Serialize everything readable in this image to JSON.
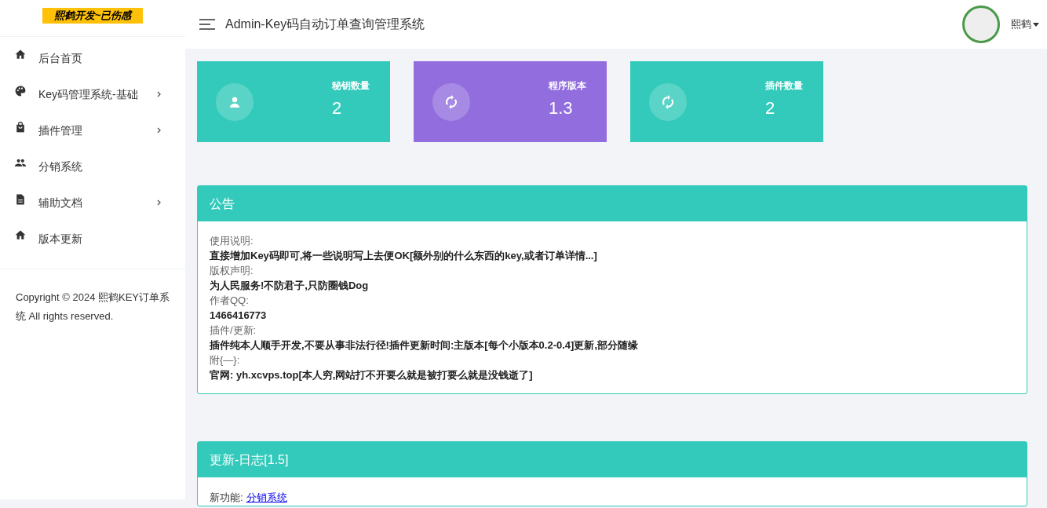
{
  "sidebar": {
    "logo": "熙鹤开发~已伤感",
    "items": [
      {
        "label": "后台首页",
        "kind": "home",
        "has_submenu": false
      },
      {
        "label": "Key码管理系统-基础",
        "kind": "palette",
        "has_submenu": true
      },
      {
        "label": "插件管理",
        "kind": "bag",
        "has_submenu": true
      },
      {
        "label": "分销系统",
        "kind": "people",
        "has_submenu": false
      },
      {
        "label": "辅助文档",
        "kind": "document",
        "has_submenu": true
      },
      {
        "label": "版本更新",
        "kind": "home",
        "has_submenu": false
      }
    ],
    "copyright": "Copyright © 2024 熙鹤KEY订单系统 All rights reserved."
  },
  "header": {
    "title": "Admin-Key码自动订单查询管理系统",
    "user": "熙鹤"
  },
  "stats": [
    {
      "label": "秘钥数量",
      "value": "2",
      "kind": "user",
      "color": "#33cabb"
    },
    {
      "label": "程序版本",
      "value": "1.3",
      "kind": "refresh",
      "color": "#926dde"
    },
    {
      "label": "插件数量",
      "value": "2",
      "kind": "refresh",
      "color": "#33cabb"
    }
  ],
  "notice": {
    "title": "公告",
    "lines": [
      {
        "kind": "label",
        "text": "使用说明:"
      },
      {
        "kind": "value",
        "text": "直接增加Key码即可,将一些说明写上去便OK[额外别的什么东西的key,或者订单详情...]"
      },
      {
        "kind": "label",
        "text": "版权声明:"
      },
      {
        "kind": "value",
        "text": "为人民服务!不防君子,只防圈钱Dog"
      },
      {
        "kind": "label",
        "text": "作者QQ:"
      },
      {
        "kind": "value",
        "text": "1466416773"
      },
      {
        "kind": "label",
        "text": "插件/更新:"
      },
      {
        "kind": "value",
        "text": "插件纯本人顺手开发,不要从事非法行径!插件更新时间:主版本[每个小版本0.2-0.4]更新,部分随缘"
      },
      {
        "kind": "label",
        "text": "附{—}:"
      },
      {
        "kind": "value",
        "text": "官网: yh.xcvps.top[本人穷,网站打不开要么就是被打要么就是没钱逝了]"
      }
    ]
  },
  "changelog": {
    "title": "更新-日志[1.5]",
    "label": "新功能:",
    "link": "分销系统"
  }
}
